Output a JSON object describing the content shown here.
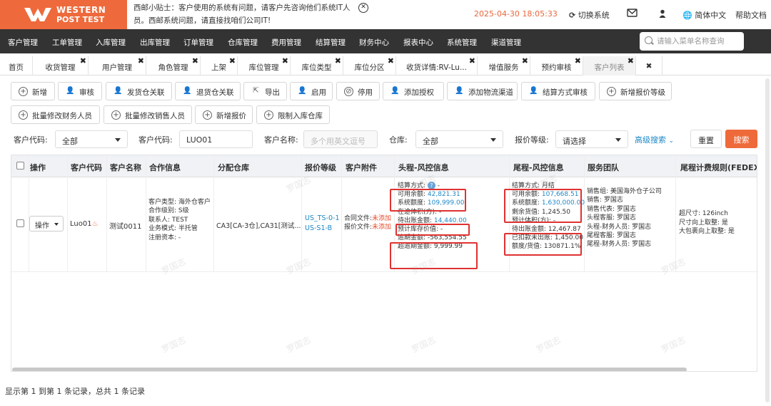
{
  "brand": {
    "line1": "WESTERN",
    "line2": "POST TEST",
    "color": "#ee6a3c"
  },
  "notice": {
    "text": "西邮小贴士：客户使用的系统有问题，请客户先咨询他们系统IT人员。西邮系统问题，请直接找咱们公司IT!"
  },
  "topbar": {
    "datetime": "2025-04-30 18:05:33",
    "switch_system": "切换系统",
    "language": "简体中文",
    "help": "帮助文档"
  },
  "menu": {
    "items": [
      "客户管理",
      "工单管理",
      "入库管理",
      "出库管理",
      "订单管理",
      "仓库管理",
      "费用管理",
      "结算管理",
      "财务中心",
      "报表中心",
      "系统管理",
      "渠道管理"
    ],
    "search_placeholder": "请输入菜单名称查询"
  },
  "tabs": [
    "首页",
    "收货管理",
    "用户管理",
    "角色管理",
    "上架",
    "库位管理",
    "库位类型",
    "库位分区",
    "收货详情:RV-Lu...",
    "增值服务",
    "预约审核",
    "客户列表"
  ],
  "toolbar": {
    "row1": [
      "新增",
      "审核",
      "发货仓关联",
      "退货仓关联",
      "导出",
      "启用",
      "停用",
      "添加授权",
      "添加物流渠道",
      "结算方式审核",
      "新增报价等级"
    ],
    "row2": [
      "批量修改财务人员",
      "批量修改销售人员",
      "新增报价",
      "限制入库仓库"
    ]
  },
  "filters": {
    "customer_code_select_label": "客户代码:",
    "customer_code_select_value": "全部",
    "customer_code_label": "客户代码:",
    "customer_code_value": "LUO01",
    "customer_name_label": "客户名称:",
    "customer_name_placeholder": "多个用英文逗号",
    "warehouse_label": "仓库:",
    "warehouse_value": "全部",
    "quote_level_label": "报价等级:",
    "quote_level_value": "请选择",
    "advanced": "高级搜索",
    "reset": "重置",
    "search": "搜索"
  },
  "table": {
    "headers": [
      "操作",
      "客户代码",
      "客户名称",
      "合作信息",
      "分配仓库",
      "报价等级",
      "客户附件",
      "头程-风控信息",
      "尾程-风控信息",
      "服务团队",
      "尾程计费规则(FEDEX)"
    ],
    "row": {
      "op_label": "操作",
      "code": "Luo01",
      "name": "测试0011",
      "coop": [
        "客户类型: 海外仓客户",
        "合作级别: S级",
        "联系人: TEST",
        "业务模式: 半托管",
        "注册资本: -"
      ],
      "warehouse": "CA3[CA-3仓],CA31[测试...",
      "quote_levels": [
        "US_TS-0-1",
        "US-S1-B"
      ],
      "attachments": [
        {
          "label": "合同文件:",
          "status": "未添加"
        },
        {
          "label": "报价文件:",
          "status": "未添加"
        }
      ],
      "head": {
        "settle_label": "结算方式:",
        "settle_value": "-",
        "available_label": "可用余额:",
        "available": "42,821.31",
        "credit_label": "系统额度:",
        "credit": "109,999.00",
        "transit_label": "在途体积(方):",
        "transit_value": "-",
        "pending_label": "待出账金额:",
        "pending": "14,440.00",
        "cover_label": "预计库存价值:",
        "cover_value": "-",
        "overdue_label": "逾期金额:",
        "overdue": "-563,554.55",
        "super_overdue_label": "超逾期金额:",
        "super_overdue": "9,999.99"
      },
      "tail": {
        "settle_line": "结算方式: 月结",
        "available_label": "可用余额:",
        "available": "107,668.51",
        "credit_label": "系统额度:",
        "credit": "1,630,000.00",
        "remain_label": "剩余货值:",
        "remain": "1,245.50",
        "transit_line": "预计体积(方): -",
        "pending_line": "待出账金额: 12,467.87",
        "deducted_line": "已扣款未出账: 1,450.00",
        "ratio_line": "额度/货值: 130871.1%"
      },
      "team": [
        "销售组: 美国海外仓子公司",
        "销售: 罗国志",
        "销售代表: 罗国志",
        "头程客服: 罗国志",
        "头程-财务人员: 罗国志",
        "尾程客服: 罗国志",
        "尾程-财务人员: 罗国志"
      ],
      "fedex": [
        "超尺寸: 126inch",
        "尺寸向上取整: 是",
        "大包裹向上取整: 是"
      ]
    }
  },
  "watermark": "罗国志",
  "footer": "显示第 1 到第 1 条记录，总共 1 条记录"
}
